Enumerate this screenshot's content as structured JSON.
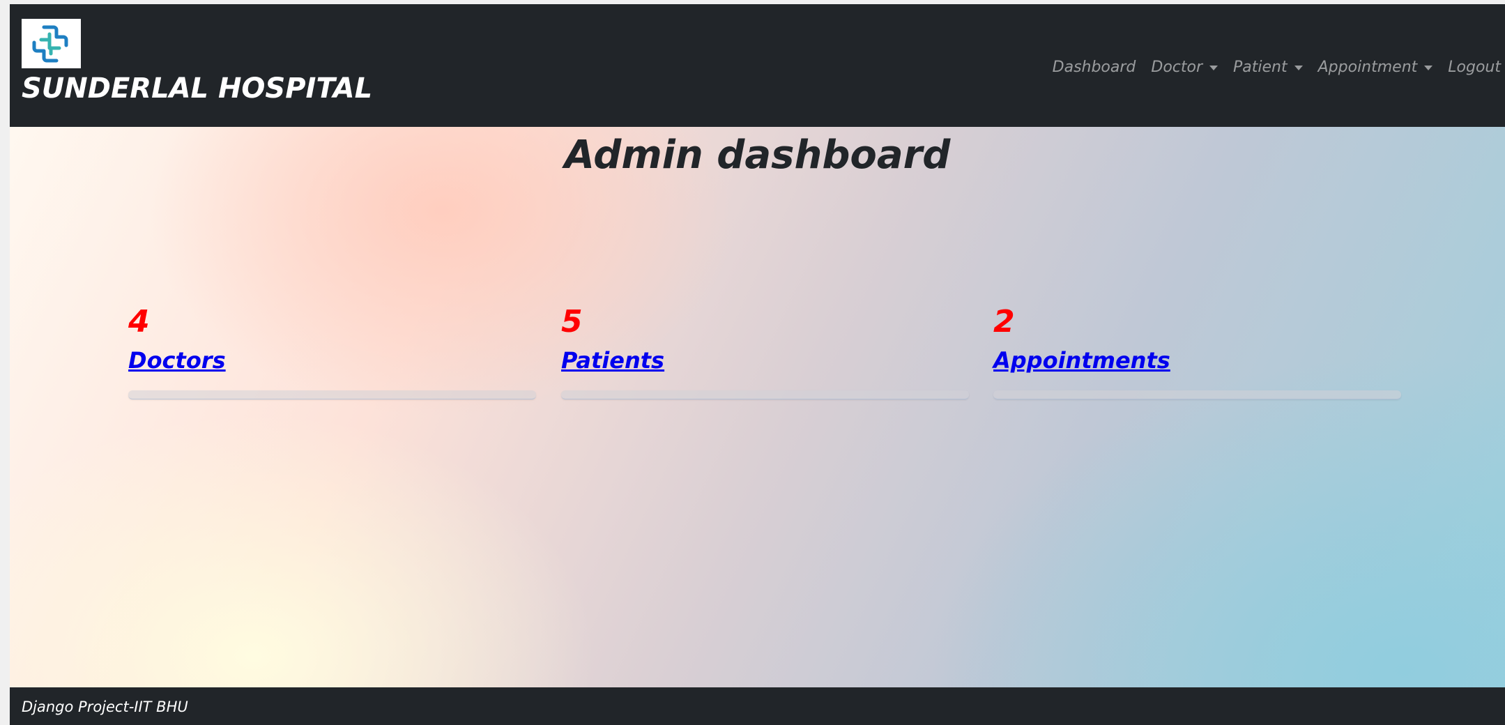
{
  "header": {
    "brand": "SUNDERLAL HOSPITAL",
    "logo_icon": "medical-cross-icon",
    "nav": [
      {
        "label": "Dashboard",
        "dropdown": false
      },
      {
        "label": "Doctor",
        "dropdown": true
      },
      {
        "label": "Patient",
        "dropdown": true
      },
      {
        "label": "Appointment",
        "dropdown": true
      },
      {
        "label": "Logout",
        "dropdown": false
      }
    ]
  },
  "main": {
    "title": "Admin dashboard",
    "stats": [
      {
        "count": "4",
        "label": "Doctors"
      },
      {
        "count": "5",
        "label": "Patients"
      },
      {
        "count": "2",
        "label": "Appointments"
      }
    ]
  },
  "footer": {
    "text": "Django Project-IIT BHU"
  },
  "colors": {
    "navbar_bg": "#212529",
    "count_color": "#ff0000",
    "link_color": "#0000ee",
    "logo_blue": "#1e7fc2",
    "logo_teal": "#35b3b0"
  }
}
